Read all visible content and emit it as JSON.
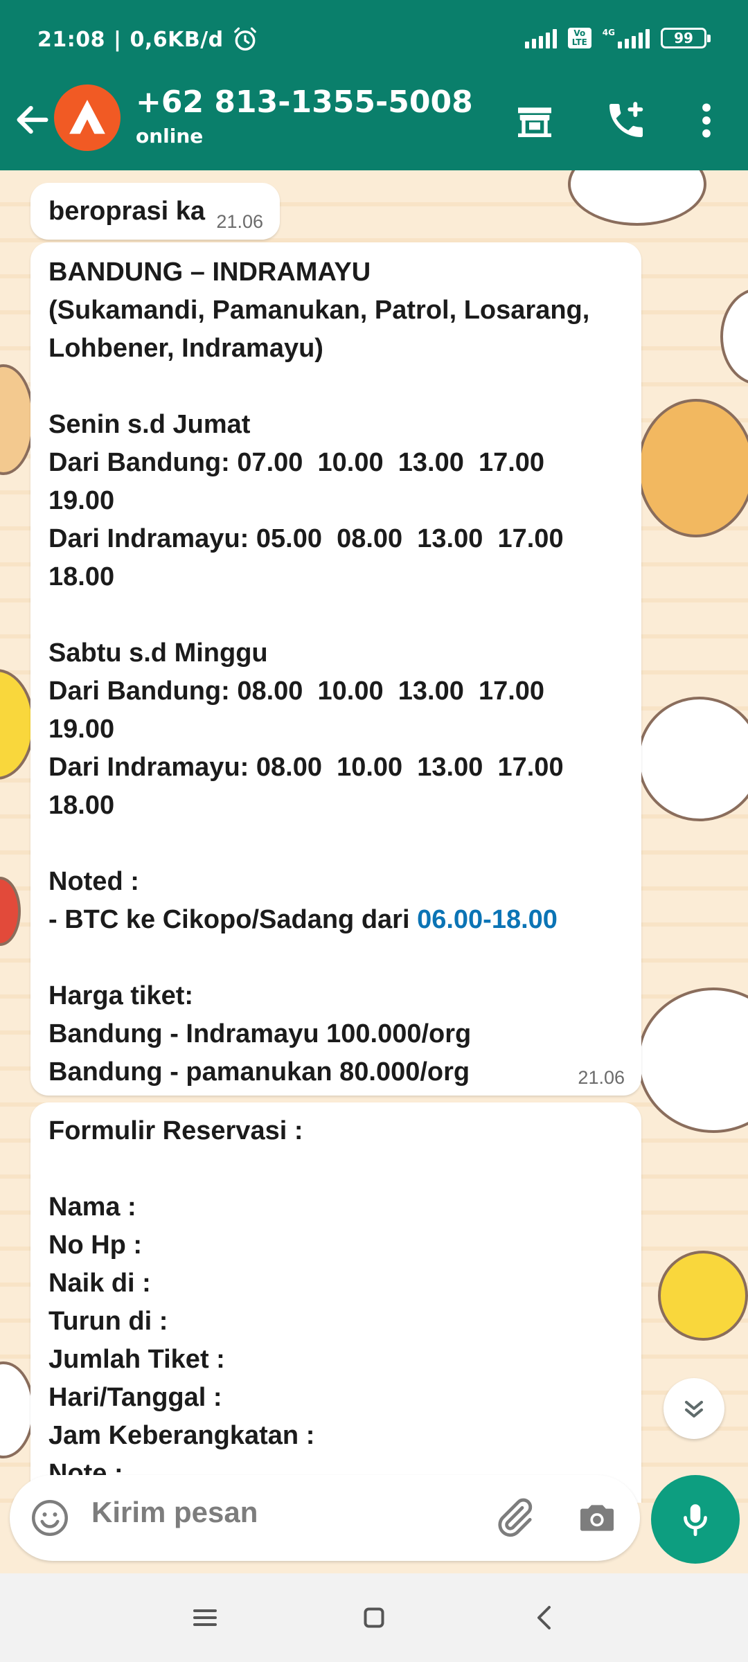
{
  "status_bar": {
    "time": "21:08",
    "separator": "|",
    "data_speed": "0,6KB/d",
    "volte": "Vo LTE",
    "network": "4G",
    "battery": "99"
  },
  "header": {
    "contact_name": "+62 813-1355-5008",
    "contact_status": "online",
    "icons": [
      "back-arrow-icon",
      "store-icon",
      "add-call-icon",
      "more-vert-icon"
    ]
  },
  "messages": [
    {
      "text": "beroprasi ka",
      "time": "21.06"
    },
    {
      "text_before_link": "BANDUNG – INDRAMAYU\n(Sukamandi, Pamanukan, Patrol, Losarang, Lohbener, Indramayu)\n\nSenin s.d Jumat\nDari Bandung: 07.00  10.00  13.00  17.00  19.00\nDari Indramayu: 05.00  08.00  13.00  17.00  18.00\n\nSabtu s.d Minggu\nDari Bandung: 08.00  10.00  13.00  17.00  19.00\nDari Indramayu: 08.00  10.00  13.00  17.00  18.00\n\nNoted :\n- BTC ke Cikopo/Sadang dari ",
      "link": "06.00-18.00",
      "text_after_link": "\n\nHarga tiket:\nBandung - Indramayu 100.000/org\nBandung - pamanukan 80.000/org",
      "time": "21.06"
    },
    {
      "text": "Formulir Reservasi :\n\nNama :\nNo Hp :\nNaik di :\nTurun di :\nJumlah Tiket :\nHari/Tanggal :\nJam Keberangkatan :\nNote :"
    }
  ],
  "input": {
    "placeholder": "Kirim pesan"
  },
  "colors": {
    "header": "#0a7f6b",
    "accent": "#0d9e80",
    "link": "#0b74b5",
    "avatar": "#f15a24"
  }
}
